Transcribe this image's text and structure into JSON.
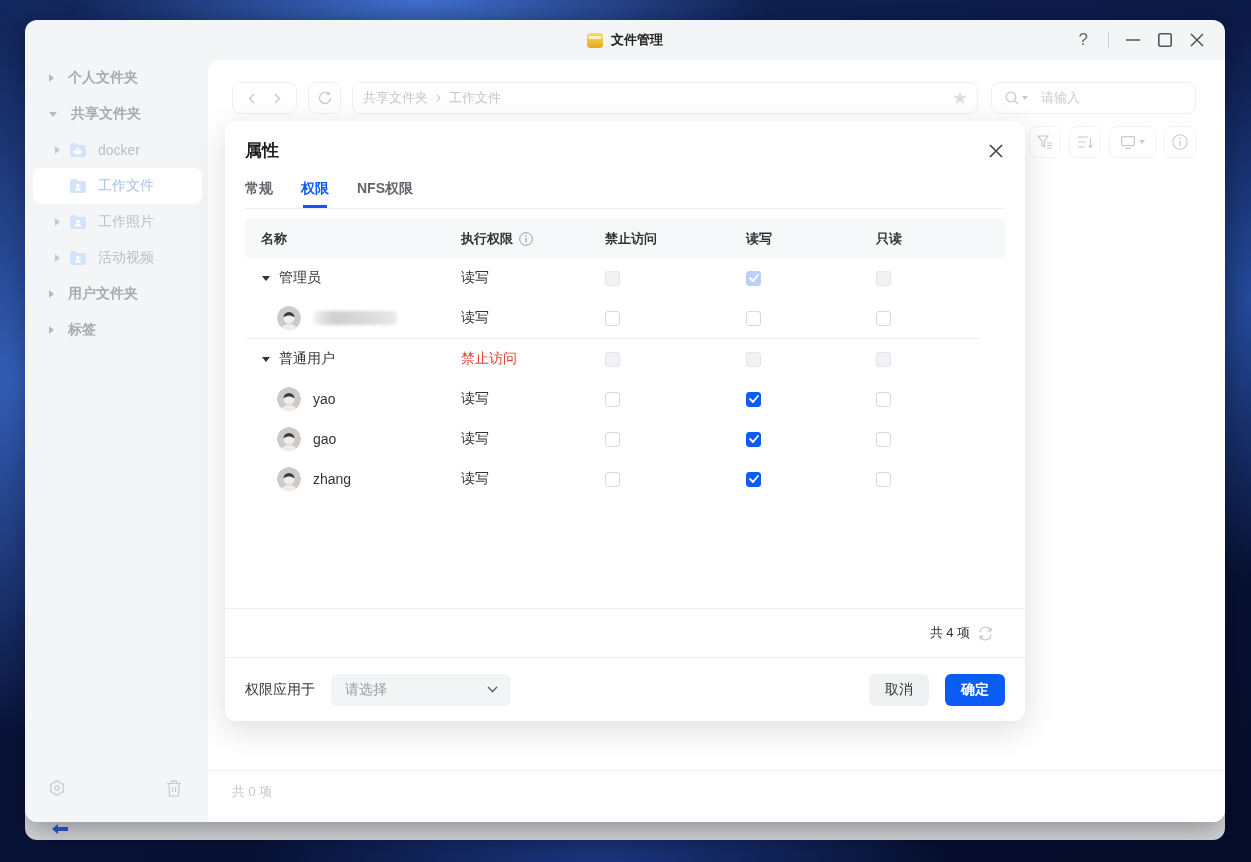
{
  "window": {
    "title": "文件管理",
    "help": "?"
  },
  "sidebar": {
    "items": [
      {
        "label": "个人文件夹",
        "expanded": false,
        "selected": false
      },
      {
        "label": "共享文件夹",
        "expanded": true,
        "selected": false,
        "children": [
          {
            "label": "docker",
            "kind": "docker",
            "expandable": true,
            "selected": false
          },
          {
            "label": "工作文件",
            "kind": "shared",
            "expandable": false,
            "selected": true
          },
          {
            "label": "工作照片",
            "kind": "shared",
            "expandable": true,
            "selected": false
          },
          {
            "label": "活动视频",
            "kind": "shared",
            "expandable": true,
            "selected": false
          }
        ]
      },
      {
        "label": "用户文件夹",
        "expanded": false,
        "selected": false
      },
      {
        "label": "标签",
        "expanded": false,
        "selected": false
      }
    ]
  },
  "toolbar": {
    "breadcrumb": [
      "共享文件夹",
      "工作文件"
    ],
    "search": {
      "placeholder": "请输入"
    }
  },
  "status_bar": {
    "count": "共 0 项"
  },
  "dialog": {
    "title": "属性",
    "tabs": [
      {
        "label": "常规",
        "selected": false
      },
      {
        "label": "权限",
        "selected": true
      },
      {
        "label": "NFS权限",
        "selected": false
      }
    ],
    "table": {
      "columns": [
        {
          "label": "名称",
          "info": false
        },
        {
          "label": "执行权限",
          "info": true
        },
        {
          "label": "禁止访问",
          "info": false
        },
        {
          "label": "读写",
          "info": false
        },
        {
          "label": "只读",
          "info": false
        }
      ],
      "groups": [
        {
          "name": "管理员",
          "expanded": true,
          "permission": "读写",
          "denied": false,
          "checks": [
            {
              "checked": false,
              "disabled": true
            },
            {
              "checked": true,
              "disabled": true
            },
            {
              "checked": false,
              "disabled": true
            }
          ],
          "users": [
            {
              "kind": "redacted",
              "permission": "读写",
              "denied": false,
              "checks": [
                {
                  "checked": false,
                  "disabled": false
                },
                {
                  "checked": false,
                  "disabled": false
                },
                {
                  "checked": false,
                  "disabled": false
                }
              ]
            }
          ]
        },
        {
          "name": "普通用户",
          "expanded": true,
          "permission": "禁止访问",
          "denied": true,
          "checks": [
            {
              "checked": false,
              "disabled": true
            },
            {
              "checked": false,
              "disabled": true
            },
            {
              "checked": false,
              "disabled": true
            }
          ],
          "users": [
            {
              "kind": "named",
              "name": "yao",
              "permission": "读写",
              "denied": false,
              "checks": [
                {
                  "checked": false,
                  "disabled": false
                },
                {
                  "checked": true,
                  "disabled": false
                },
                {
                  "checked": false,
                  "disabled": false
                }
              ]
            },
            {
              "kind": "named",
              "name": "gao",
              "permission": "读写",
              "denied": false,
              "checks": [
                {
                  "checked": false,
                  "disabled": false
                },
                {
                  "checked": true,
                  "disabled": false
                },
                {
                  "checked": false,
                  "disabled": false
                }
              ]
            },
            {
              "kind": "named",
              "name": "zhang",
              "permission": "读写",
              "denied": false,
              "checks": [
                {
                  "checked": false,
                  "disabled": false
                },
                {
                  "checked": true,
                  "disabled": false
                },
                {
                  "checked": false,
                  "disabled": false
                }
              ]
            }
          ]
        }
      ]
    },
    "count": "共 4 项",
    "apply_to": {
      "label": "权限应用于",
      "placeholder": "请选择"
    },
    "buttons": [
      {
        "label": "取消",
        "kind": "secondary"
      },
      {
        "label": "确定",
        "kind": "primary"
      }
    ]
  }
}
